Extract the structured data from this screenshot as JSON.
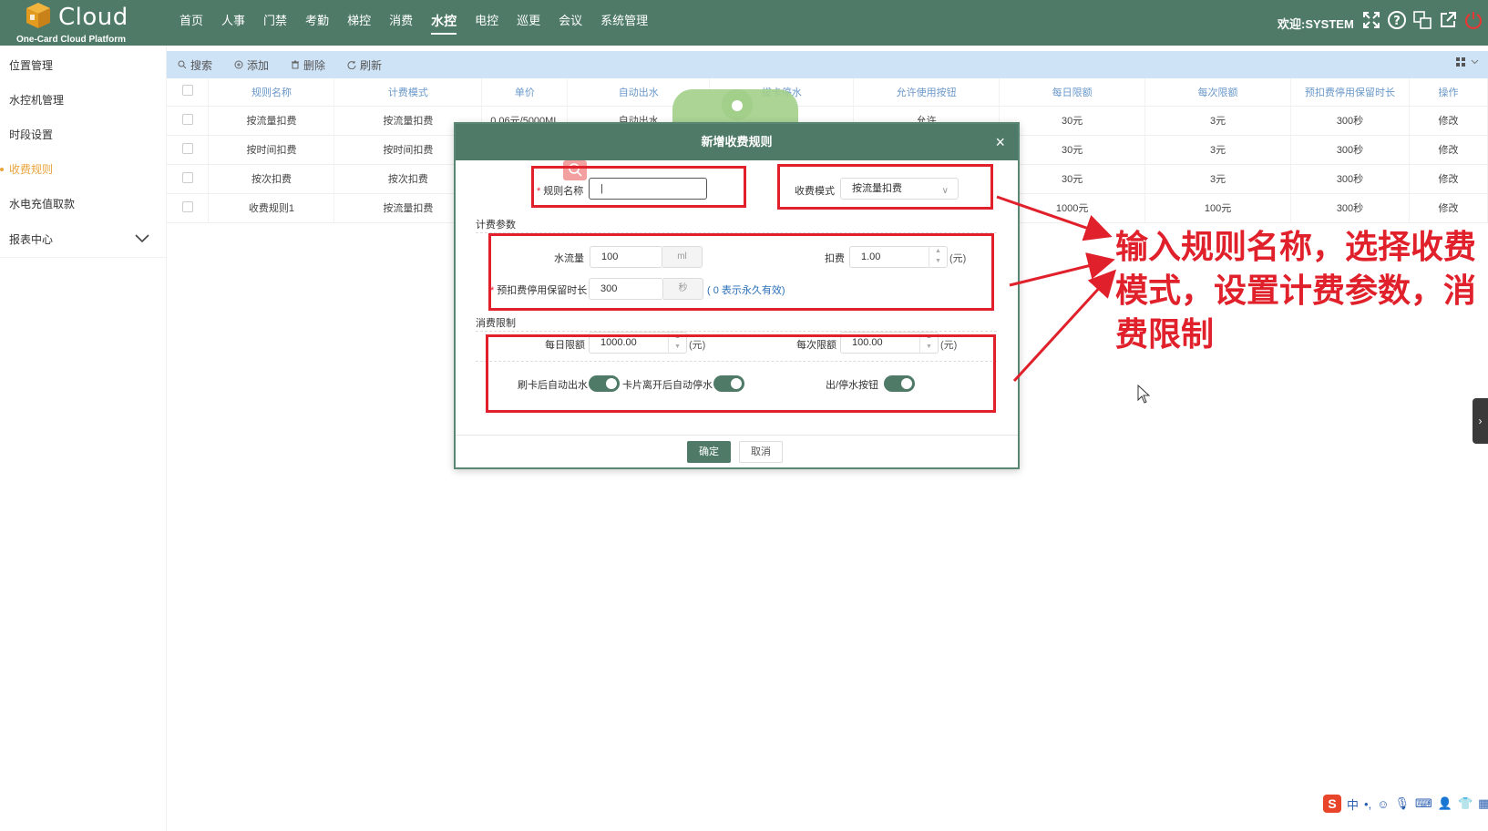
{
  "app": {
    "logo_text": "Cloud",
    "logo_sub": "One-Card Cloud Platform",
    "welcome": "欢迎:SYSTEM"
  },
  "nav": [
    "首页",
    "人事",
    "门禁",
    "考勤",
    "梯控",
    "消费",
    "水控",
    "电控",
    "巡更",
    "会议",
    "系统管理"
  ],
  "nav_active": "水控",
  "sidebar": {
    "items": [
      "位置管理",
      "水控机管理",
      "时段设置",
      "收费规则",
      "水电充值取款"
    ],
    "active": "收费规则",
    "group": "报表中心"
  },
  "toolbar": {
    "search": "搜索",
    "add": "添加",
    "delete": "删除",
    "refresh": "刷新"
  },
  "table": {
    "columns": [
      "规则名称",
      "计费模式",
      "单价",
      "自动出水",
      "拔卡停水",
      "允许使用按钮",
      "每日限额",
      "每次限额",
      "预扣费停用保留时长",
      "操作"
    ],
    "rows": [
      [
        "按流量扣费",
        "按流量扣费",
        "0.06元/5000ML",
        "自动出水",
        "",
        "允许",
        "30元",
        "3元",
        "300秒",
        "修改"
      ],
      [
        "按时间扣费",
        "按时间扣费",
        "",
        "",
        "",
        "",
        "30元",
        "3元",
        "300秒",
        "修改"
      ],
      [
        "按次扣费",
        "按次扣费",
        "",
        "",
        "",
        "",
        "30元",
        "3元",
        "300秒",
        "修改"
      ],
      [
        "收费规则1",
        "按流量扣费",
        "",
        "",
        "",
        "",
        "1000元",
        "100元",
        "300秒",
        "修改"
      ]
    ]
  },
  "dialog": {
    "title": "新增收费规则",
    "close": "×",
    "rule_name_label": "规则名称",
    "rule_name_value": "|",
    "mode_label": "收费模式",
    "mode_value": "按流量扣费",
    "section_billing": "计费参数",
    "flow_label": "水流量",
    "flow_value": "100",
    "flow_unit": "ml",
    "fee_label": "扣费",
    "fee_value": "1.00",
    "fee_unit": "(元)",
    "hold_label": "预扣费停用保留时长",
    "hold_value": "300",
    "hold_unit": "秒",
    "hold_hint": "( 0 表示永久有效)",
    "section_limit": "消费限制",
    "daily_label": "每日限额",
    "daily_value": "1000.00",
    "daily_unit": "(元)",
    "each_label": "每次限额",
    "each_value": "100.00",
    "each_unit": "(元)",
    "auto_out_label": "刷卡后自动出水",
    "auto_stop_label": "卡片离开后自动停水",
    "button_label": "出/停水按钮",
    "ok": "确定",
    "cancel": "取消"
  },
  "annotation": "输入规则名称，选择收费模式，设置计费参数，消费限制",
  "colors": {
    "primary": "#4e7a67",
    "accent": "#e8a33a",
    "annotation": "#e0202a",
    "toolbar": "#cfe3f7"
  }
}
